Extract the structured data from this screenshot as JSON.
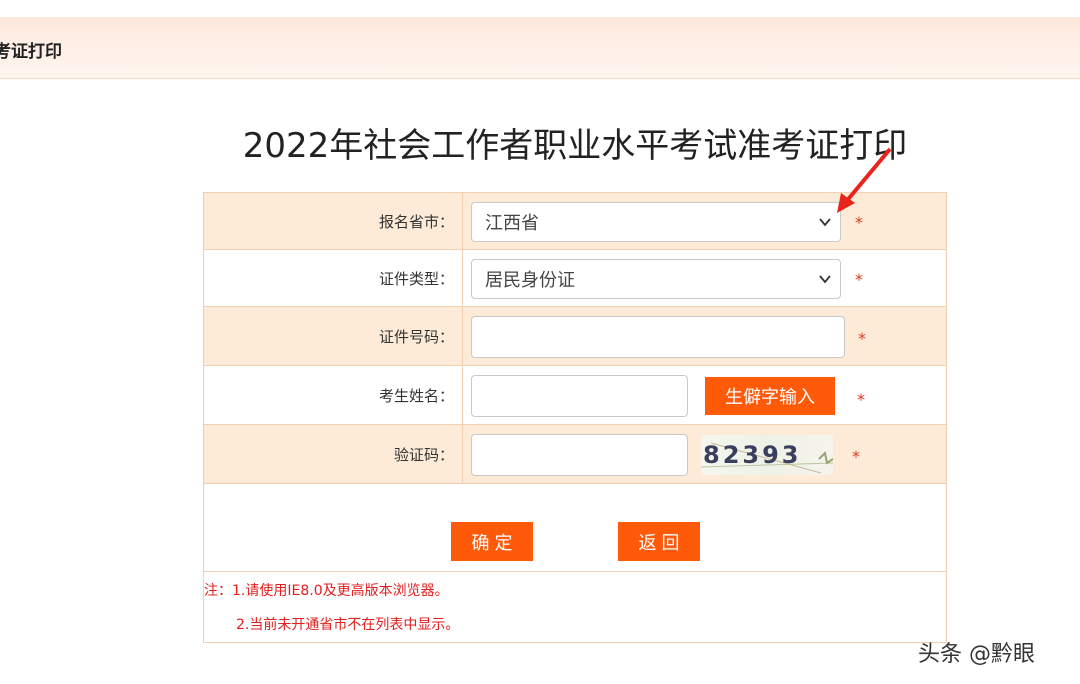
{
  "header": {
    "breadcrumb": "考证打印"
  },
  "page_title": "2022年社会工作者职业水平考试准考证打印",
  "form": {
    "province": {
      "label": "报名省市：",
      "value": "江西省"
    },
    "id_type": {
      "label": "证件类型：",
      "value": "居民身份证"
    },
    "id_number": {
      "label": "证件号码：",
      "value": ""
    },
    "name": {
      "label": "考生姓名：",
      "value": "",
      "rare_char_button": "生僻字输入"
    },
    "captcha": {
      "label": "验证码：",
      "value": "",
      "code": "82393"
    },
    "required_mark": "*"
  },
  "actions": {
    "confirm": "确 定",
    "back": "返 回"
  },
  "notes": {
    "line1": "注：1.请使用IE8.0及更高版本浏览器。",
    "line2": "2.当前未开通省市不在列表中显示。"
  },
  "watermark": "头条 @黔眼",
  "colors": {
    "accent": "#ff5a0a",
    "required": "#e03a1e",
    "note": "#e02020",
    "row_band": "#fdebd7"
  }
}
